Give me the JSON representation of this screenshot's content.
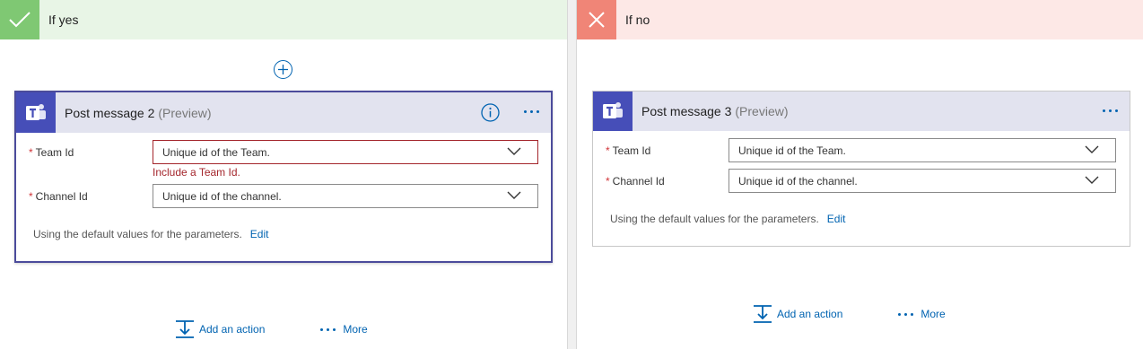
{
  "branches": {
    "yes": {
      "title": "If yes",
      "card": {
        "title": "Post message 2",
        "preview": "(Preview)",
        "fields": [
          {
            "label": "Team Id",
            "placeholder": "Unique id of the Team.",
            "error": "Include a Team Id."
          },
          {
            "label": "Channel Id",
            "placeholder": "Unique id of the channel."
          }
        ],
        "defaults_note": "Using the default values for the parameters.",
        "edit_label": "Edit"
      },
      "actions": {
        "add": "Add an action",
        "more": "More"
      }
    },
    "no": {
      "title": "If no",
      "card": {
        "title": "Post message 3",
        "preview": "(Preview)",
        "fields": [
          {
            "label": "Team Id",
            "placeholder": "Unique id of the Team."
          },
          {
            "label": "Channel Id",
            "placeholder": "Unique id of the channel."
          }
        ],
        "defaults_note": "Using the default values for the parameters.",
        "edit_label": "Edit"
      },
      "actions": {
        "add": "Add an action",
        "more": "More"
      }
    }
  },
  "required_marker": "*",
  "icons": {
    "yes_header": "checkmark-icon",
    "no_header": "close-icon",
    "card_logo": "teams-logo-icon",
    "info": "info-icon",
    "card_menu": "more-dots-icon",
    "dropdown": "chevron-down-icon",
    "insert_step": "plus-circle-icon",
    "add_action": "add-action-icon"
  },
  "colors": {
    "yes_accent": "#7fc873",
    "yes_bg": "#e8f5e6",
    "no_accent": "#f08577",
    "no_bg": "#fde8e6",
    "teams_purple": "#464eb8",
    "card_header_bg": "#e2e3ef",
    "link_blue": "#0063b1",
    "error_red": "#a4262c"
  }
}
